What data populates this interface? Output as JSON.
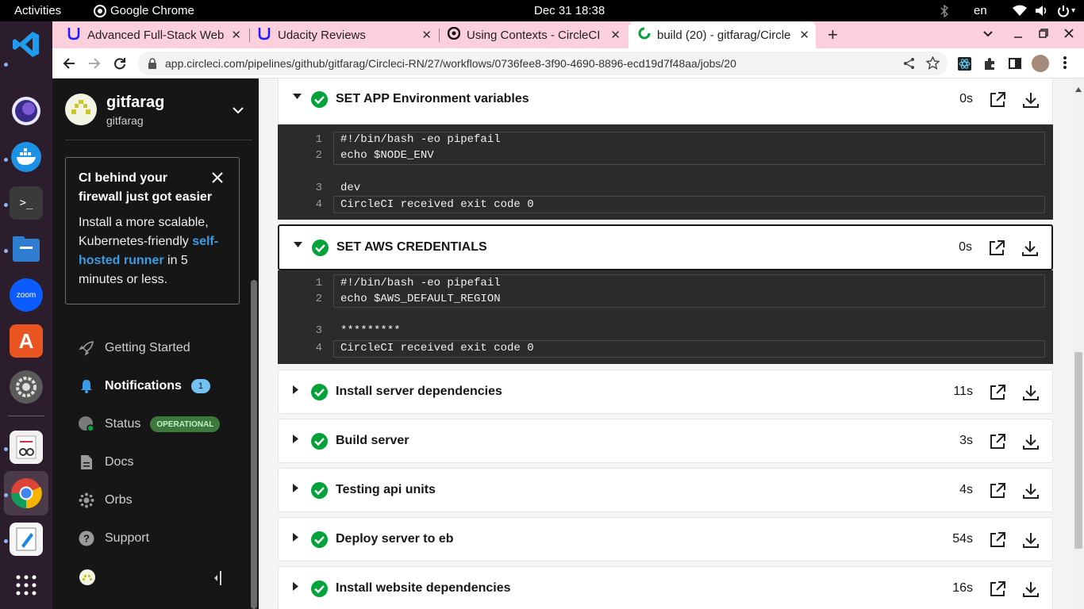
{
  "system": {
    "activities": "Activities",
    "app_name": "Google Chrome",
    "datetime": "Dec 31  18:38",
    "lang": "en"
  },
  "browser": {
    "tabs": [
      {
        "title": "Advanced Full-Stack Web",
        "close": "✕"
      },
      {
        "title": "Udacity Reviews",
        "close": "✕"
      },
      {
        "title": "Using Contexts - CircleCI",
        "close": "✕"
      },
      {
        "title": "build (20) - gitfarag/Circle",
        "close": "✕"
      }
    ],
    "new_tab": "+",
    "url": "app.circleci.com/pipelines/github/gitfarag/Circleci-RN/27/workflows/0736fee8-3f90-4690-8896-ecd19d7f48aa/jobs/20"
  },
  "sidebar": {
    "org_name": "gitfarag",
    "org_user": "gitfarag",
    "promo": {
      "title": "CI behind your firewall just got easier",
      "body_pre": "Install a more scalable, Kubernetes-friendly ",
      "link": "self-hosted runner",
      "body_post": " in 5 minutes or less."
    },
    "nav": [
      {
        "label": "Getting Started"
      },
      {
        "label": "Notifications",
        "badge": "1"
      },
      {
        "label": "Status",
        "badge": "OPERATIONAL"
      },
      {
        "label": "Docs"
      },
      {
        "label": "Orbs"
      },
      {
        "label": "Support"
      }
    ]
  },
  "steps": [
    {
      "name": "SET APP Environment variables",
      "duration": "0s",
      "expanded": true,
      "log": {
        "cmd": [
          {
            "n": "1",
            "t": "#!/bin/bash -eo pipefail"
          },
          {
            "n": "2",
            "t": "echo $NODE_ENV"
          }
        ],
        "out": [
          {
            "n": "3",
            "t": "dev"
          },
          {
            "n": "4",
            "t": "CircleCI received exit code 0"
          }
        ]
      }
    },
    {
      "name": "SET AWS CREDENTIALS",
      "duration": "0s",
      "expanded": true,
      "log": {
        "cmd": [
          {
            "n": "1",
            "t": "#!/bin/bash -eo pipefail"
          },
          {
            "n": "2",
            "t": "echo $AWS_DEFAULT_REGION"
          }
        ],
        "out": [
          {
            "n": "3",
            "t": "*********"
          },
          {
            "n": "4",
            "t": "CircleCI received exit code 0"
          }
        ]
      }
    },
    {
      "name": "Install server dependencies",
      "duration": "11s",
      "expanded": false
    },
    {
      "name": "Build server",
      "duration": "3s",
      "expanded": false
    },
    {
      "name": "Testing api units",
      "duration": "4s",
      "expanded": false
    },
    {
      "name": "Deploy server to eb",
      "duration": "54s",
      "expanded": false
    },
    {
      "name": "Install website dependencies",
      "duration": "16s",
      "expanded": false
    }
  ],
  "colors": {
    "success": "#04a23b",
    "accent": "#3b9ce5",
    "badge_operational": "#3c7a3c"
  }
}
